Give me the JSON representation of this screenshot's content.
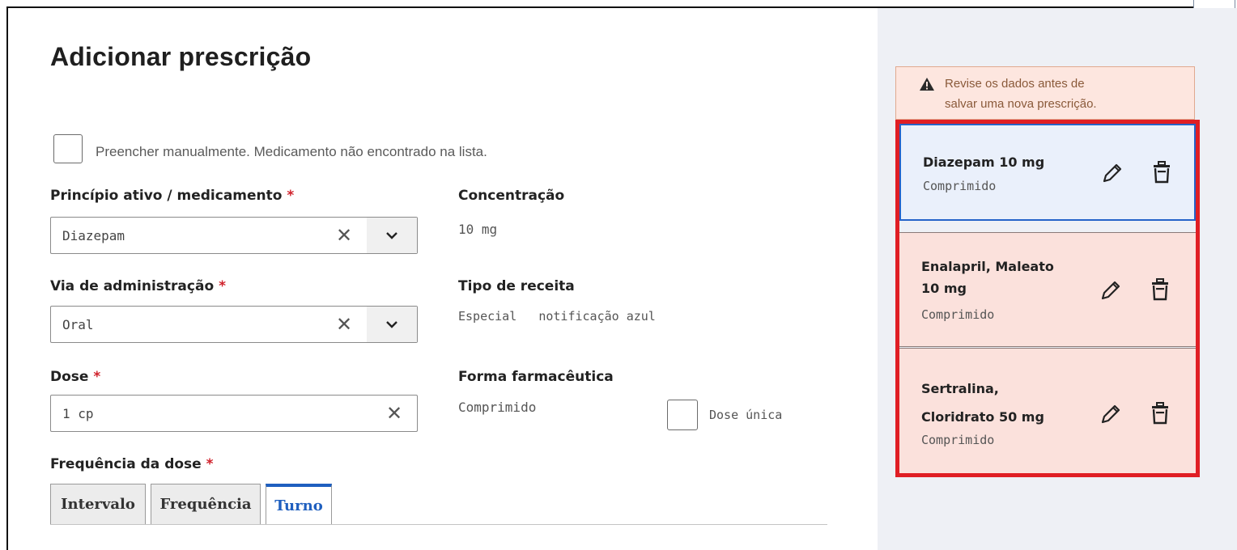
{
  "modal": {
    "title": "Adicionar prescrição",
    "close_label": "✕"
  },
  "manual": {
    "label": "Preencher manualmente. Medicamento não encontrado na lista.",
    "checked": false
  },
  "fields": {
    "principio": {
      "label": "Princípio ativo / medicamento",
      "required": "*",
      "value": "Diazepam"
    },
    "via": {
      "label": "Via de administração",
      "required": "*",
      "value": "Oral"
    },
    "dose": {
      "label": "Dose",
      "required": "*",
      "value": "1 cp"
    },
    "frequencia": {
      "label": "Frequência da dose",
      "required": "*"
    }
  },
  "info": {
    "concentracao": {
      "label": "Concentração",
      "value": "10 mg"
    },
    "tipo_receita": {
      "label": "Tipo de receita",
      "value": "Especial   notificação azul"
    },
    "forma": {
      "label": "Forma farmacêutica",
      "value": "Comprimido"
    }
  },
  "dose_unica": {
    "label": "Dose única",
    "checked": false
  },
  "tabs": [
    {
      "label": "Intervalo",
      "active": false
    },
    {
      "label": "Frequência",
      "active": false
    },
    {
      "label": "Turno",
      "active": true
    }
  ],
  "alert": {
    "icon": "warning-icon",
    "line1": "Revise os dados antes de",
    "line2": "salvar uma nova prescrição."
  },
  "prescriptions": [
    {
      "name_lines": [
        "Diazepam 10 mg"
      ],
      "form": "Comprimido",
      "selected": true
    },
    {
      "name_lines": [
        "Enalapril, Maleato",
        "10 mg"
      ],
      "form": "Comprimido",
      "selected": false
    },
    {
      "name_lines": [
        "Sertralina,",
        "Cloridrato 50 mg"
      ],
      "form": "Comprimido",
      "selected": false
    }
  ],
  "colors": {
    "required": "#d0212b",
    "accent": "#1f5fbf",
    "highlight_border": "#e01e24",
    "card_bg": "#fbe1dc",
    "card_selected_bg": "#eaf0fb"
  }
}
